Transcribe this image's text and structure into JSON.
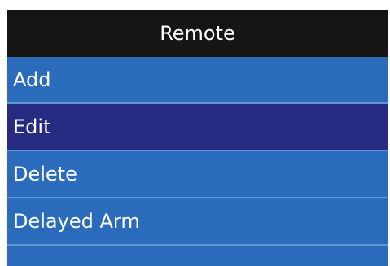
{
  "window": {
    "title": "Remote"
  },
  "menu": {
    "items": [
      {
        "label": "Add",
        "selected": false
      },
      {
        "label": "Edit",
        "selected": true
      },
      {
        "label": "Delete",
        "selected": false
      },
      {
        "label": "Delayed Arm",
        "selected": false
      }
    ],
    "empty_row": ""
  },
  "colors": {
    "title_background": "#151515",
    "menu_background": "#2a6cbb",
    "selected_background": "#262a80",
    "divider": "#5f95d2",
    "text": "#ffffff"
  }
}
